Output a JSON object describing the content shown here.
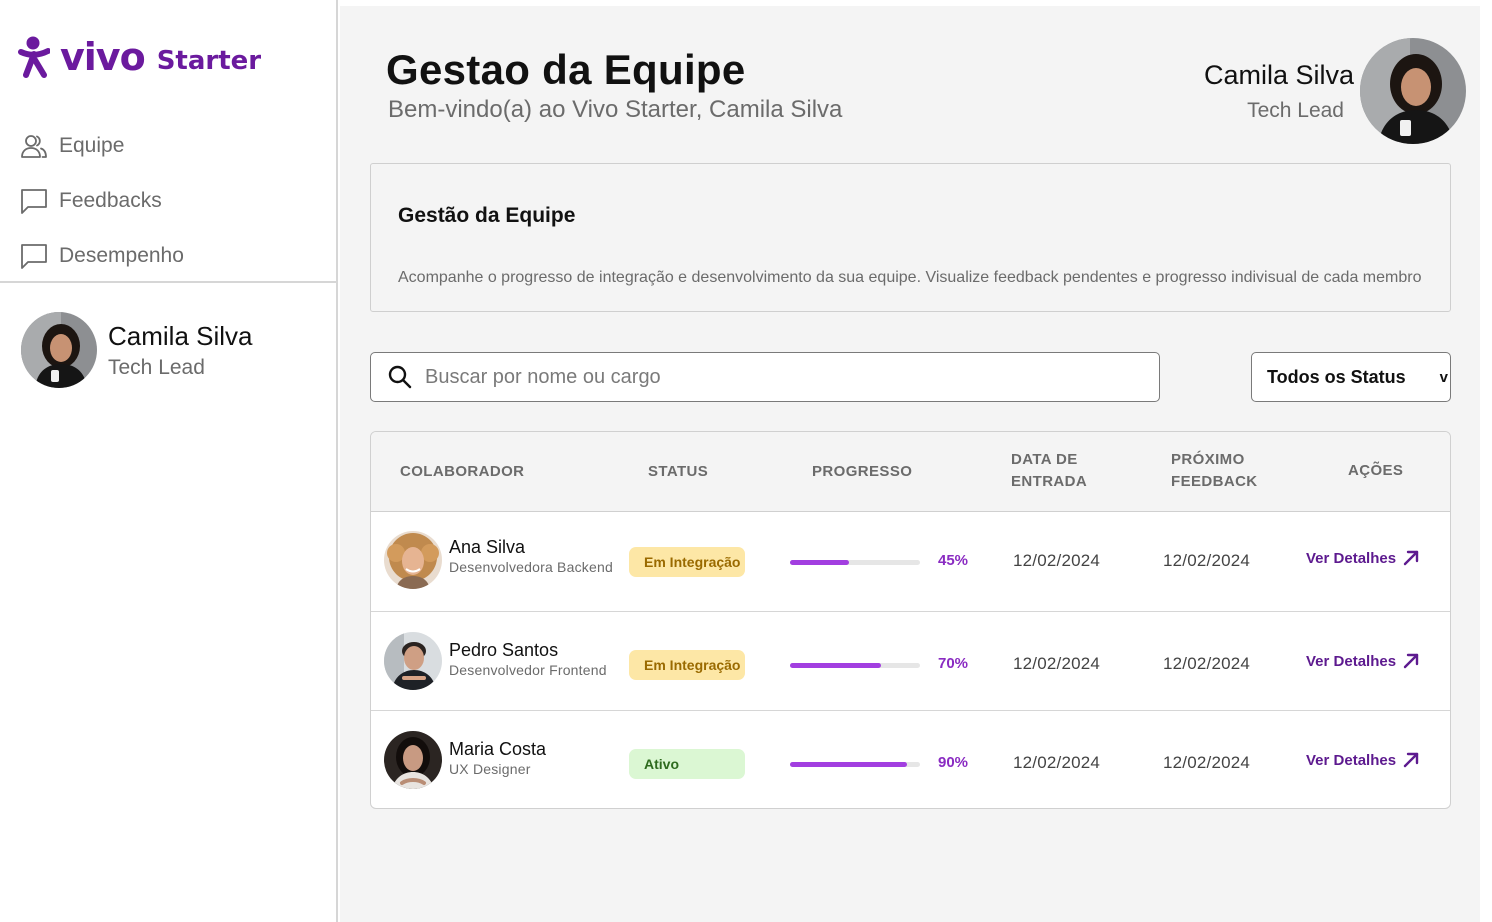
{
  "brand": {
    "name": "vivo",
    "product": "Starter",
    "color": "#6b1a9e"
  },
  "sidebar": {
    "items": [
      {
        "label": "Equipe",
        "icon": "users-icon"
      },
      {
        "label": "Feedbacks",
        "icon": "message-square-icon"
      },
      {
        "label": "Desempenho",
        "icon": "message-square-icon"
      }
    ],
    "user": {
      "name": "Camila Silva",
      "role": "Tech Lead"
    }
  },
  "header": {
    "title": "Gestao da Equipe",
    "subtitle": "Bem-vindo(a) ao Vivo Starter, Camila Silva",
    "user": {
      "name": "Camila Silva",
      "role": "Tech Lead"
    }
  },
  "info_card": {
    "title": "Gestão da Equipe",
    "description": "Acompanhe o progresso de integração e desenvolvimento da sua equipe. Visualize feedback pendentes e progresso indivisual de cada membro"
  },
  "search": {
    "placeholder": "Buscar por nome ou cargo"
  },
  "status_filter": {
    "selected": "Todos os Status",
    "caret": "v"
  },
  "table": {
    "columns": {
      "colaborador": "COLABORADOR",
      "status": "STATUS",
      "progresso": "PROGRESSO",
      "entrada_1": "DATA DE",
      "entrada_2": "ENTRADA",
      "feedback_1": "PRÓXIMO",
      "feedback_2": "FEEDBACK",
      "acoes": "AÇÕES"
    },
    "rows": [
      {
        "name": "Ana Silva",
        "role": "Desenvolvedora Backend",
        "status": "Em Integração",
        "status_type": "integ",
        "progress": 0.45,
        "progress_label": "45%",
        "entry_date": "12/02/2024",
        "next_feedback": "12/02/2024",
        "action": "Ver Detalhes"
      },
      {
        "name": "Pedro Santos",
        "role": "Desenvolvedor Frontend",
        "status": "Em Integração",
        "status_type": "integ",
        "progress": 0.7,
        "progress_label": "70%",
        "entry_date": "12/02/2024",
        "next_feedback": "12/02/2024",
        "action": "Ver Detalhes"
      },
      {
        "name": "Maria Costa",
        "role": "UX Designer",
        "status": "Ativo",
        "status_type": "ativo",
        "progress": 0.9,
        "progress_label": "90%",
        "entry_date": "12/02/2024",
        "next_feedback": "12/02/2024",
        "action": "Ver Detalhes"
      }
    ]
  },
  "colors": {
    "accent": "#a23ee0",
    "link": "#5d1a8f",
    "badge_integ_bg": "#fde7a6",
    "badge_ativo_bg": "#dbf7d3"
  }
}
